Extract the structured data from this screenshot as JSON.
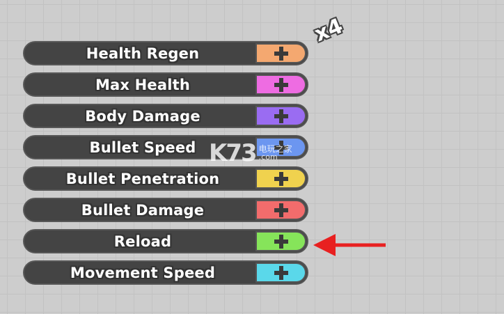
{
  "multiplier": "x4",
  "stats": [
    {
      "label": "Health Regen",
      "color": "#f4a870"
    },
    {
      "label": "Max Health",
      "color": "#ee6ce2"
    },
    {
      "label": "Body Damage",
      "color": "#9a6cf2"
    },
    {
      "label": "Bullet Speed",
      "color": "#6c96f0"
    },
    {
      "label": "Bullet Penetration",
      "color": "#f0d24e"
    },
    {
      "label": "Bullet Damage",
      "color": "#f26c6c"
    },
    {
      "label": "Reload",
      "color": "#86e45a"
    },
    {
      "label": "Movement Speed",
      "color": "#5ad8ea"
    }
  ],
  "watermark": {
    "logo": "K73",
    "cn": "电玩之家",
    "url": ".com"
  },
  "annotation_arrow_color": "#e82020"
}
